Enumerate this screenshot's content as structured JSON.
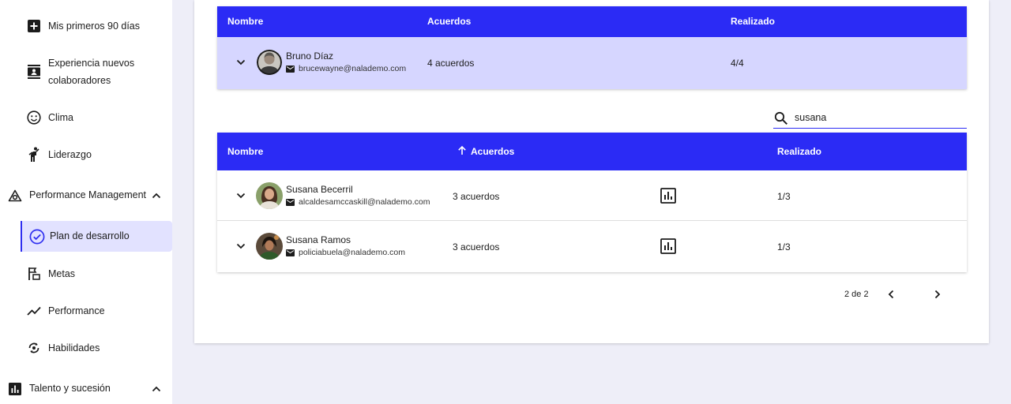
{
  "sidebar": {
    "items": [
      {
        "label": "Mis primeros 90 días",
        "icon": "plus-box-icon"
      },
      {
        "label": "Experiencia nuevos",
        "label2": "colaboradores",
        "icon": "contact-card-icon"
      },
      {
        "label": "Clima",
        "icon": "smiley-icon"
      },
      {
        "label": "Liderazgo",
        "icon": "person-walking-icon"
      }
    ],
    "performance_section": {
      "label": "Performance Management",
      "icon": "performance-logo-icon"
    },
    "performance_items": [
      {
        "label": "Plan de desarrollo",
        "icon": "check-circle-icon",
        "active": true
      },
      {
        "label": "Metas",
        "icon": "flag-icon"
      },
      {
        "label": "Performance",
        "icon": "trend-line-icon"
      },
      {
        "label": "Habilidades",
        "icon": "skills-icon"
      }
    ],
    "talent_section": {
      "label": "Talento y sucesión",
      "icon": "bar-chart-icon"
    }
  },
  "top_table": {
    "headers": {
      "name": "Nombre",
      "agreements": "Acuerdos",
      "done": "Realizado"
    },
    "row": {
      "name": "Bruno Díaz",
      "email": "brucewayne@nalademo.com",
      "agreements": "4 acuerdos",
      "done": "4/4"
    }
  },
  "search": {
    "value": "susana"
  },
  "bottom_table": {
    "headers": {
      "name": "Nombre",
      "agreements": "Acuerdos",
      "done": "Realizado",
      "sort": "arrow-up-icon"
    },
    "rows": [
      {
        "name": "Susana Becerril",
        "email": "alcaldesamccaskill@nalademo.com",
        "agreements": "3 acuerdos",
        "done": "1/3"
      },
      {
        "name": "Susana Ramos",
        "email": "policiabuela@nalademo.com",
        "agreements": "3 acuerdos",
        "done": "1/3"
      }
    ]
  },
  "pagination": {
    "text": "2 de 2"
  },
  "colors": {
    "accent": "#2b2bf5",
    "highlight_row": "#d6d6ff",
    "active_nav": "#e2e2ff",
    "background": "#eeeef8"
  }
}
